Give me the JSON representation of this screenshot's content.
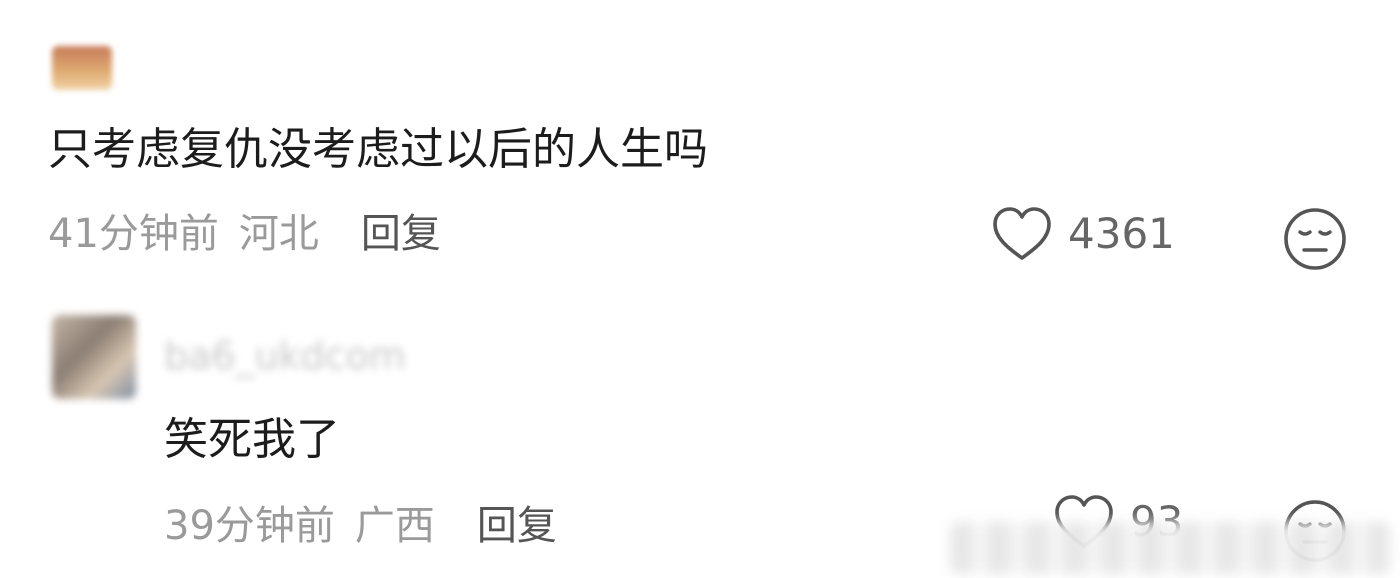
{
  "comments": [
    {
      "text": "只考虑复仇没考虑过以后的人生吗",
      "time": "41分钟前",
      "region": "河北",
      "reply_label": "回复",
      "likes": "4361"
    },
    {
      "username": "ba6_ukdcom",
      "text": "笑死我了",
      "time": "39分钟前",
      "region": "广西",
      "reply_label": "回复",
      "likes": "93"
    }
  ],
  "icons": {
    "like": "heart-outline-icon",
    "reaction": "meh-face-icon"
  },
  "colors": {
    "primary_text": "#1c1c1c",
    "meta_text": "#9a9a9a",
    "reply_text": "#555555",
    "icon_stroke": "#555555"
  }
}
